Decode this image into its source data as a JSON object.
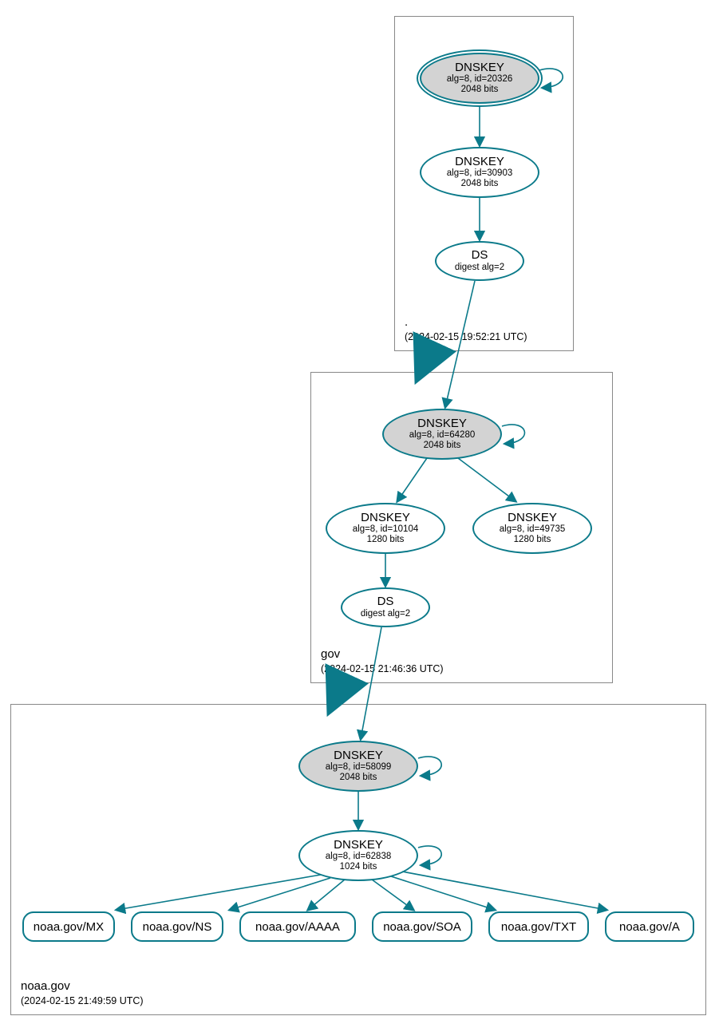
{
  "colors": {
    "stroke": "#0b7a8a",
    "ksk_fill": "#d3d3d3"
  },
  "zones": {
    "root": {
      "name": ".",
      "timestamp": "(2024-02-15 19:52:21 UTC)"
    },
    "gov": {
      "name": "gov",
      "timestamp": "(2024-02-15 21:46:36 UTC)"
    },
    "noaa": {
      "name": "noaa.gov",
      "timestamp": "(2024-02-15 21:49:59 UTC)"
    }
  },
  "nodes": {
    "root_ksk": {
      "title": "DNSKEY",
      "line1": "alg=8, id=20326",
      "line2": "2048 bits"
    },
    "root_zsk": {
      "title": "DNSKEY",
      "line1": "alg=8, id=30903",
      "line2": "2048 bits"
    },
    "root_ds": {
      "title": "DS",
      "line1": "digest alg=2"
    },
    "gov_ksk": {
      "title": "DNSKEY",
      "line1": "alg=8, id=64280",
      "line2": "2048 bits"
    },
    "gov_zsk1": {
      "title": "DNSKEY",
      "line1": "alg=8, id=10104",
      "line2": "1280 bits"
    },
    "gov_zsk2": {
      "title": "DNSKEY",
      "line1": "alg=8, id=49735",
      "line2": "1280 bits"
    },
    "gov_ds": {
      "title": "DS",
      "line1": "digest alg=2"
    },
    "noaa_ksk": {
      "title": "DNSKEY",
      "line1": "alg=8, id=58099",
      "line2": "2048 bits"
    },
    "noaa_zsk": {
      "title": "DNSKEY",
      "line1": "alg=8, id=62838",
      "line2": "1024 bits"
    }
  },
  "rrsets": {
    "mx": "noaa.gov/MX",
    "ns": "noaa.gov/NS",
    "aaaa": "noaa.gov/AAAA",
    "soa": "noaa.gov/SOA",
    "txt": "noaa.gov/TXT",
    "a": "noaa.gov/A"
  }
}
